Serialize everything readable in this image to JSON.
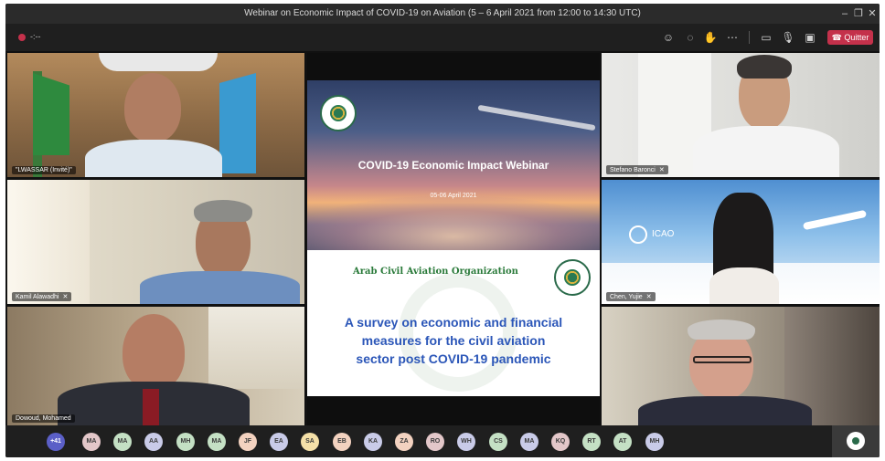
{
  "window": {
    "title": "Webinar on Economic Impact of COVID-19 on Aviation (5 – 6 April 2021 from 12:00 to 14:30 UTC)"
  },
  "toolbar": {
    "timer": "-:--",
    "leave_label": "Quitter"
  },
  "participants": [
    {
      "name": "\"LWASSAR (Invité)\""
    },
    {
      "name": "Kamil Alawadhi"
    },
    {
      "name": "Dowoud, Mohamed"
    },
    {
      "name": "Stefano Baronci"
    },
    {
      "name": "Chen, Yujie"
    },
    {
      "name": ""
    }
  ],
  "presentation": {
    "title": "COVID-19 Economic Impact Webinar",
    "date": "05-06 April 2021",
    "org_name": "Arab Civil Aviation Organization",
    "survey_lines": [
      "A survey on economic and financial",
      "measures for the civil aviation",
      "sector post COVID-19 pandemic"
    ],
    "icao_label": "ICAO"
  },
  "overflow_count": "+41",
  "avatars": [
    {
      "initials": "MA",
      "color": "#e3c7c9"
    },
    {
      "initials": "MA",
      "color": "#c4e0c4"
    },
    {
      "initials": "AA",
      "color": "#c9cbe8"
    },
    {
      "initials": "MH",
      "color": "#c4e0c4"
    },
    {
      "initials": "MA",
      "color": "#c4e0c4"
    },
    {
      "initials": "JF",
      "color": "#f3d2c0"
    },
    {
      "initials": "EA",
      "color": "#c9cbe8"
    },
    {
      "initials": "SA",
      "color": "#f5e0a8"
    },
    {
      "initials": "EB",
      "color": "#f3d2c0"
    },
    {
      "initials": "KA",
      "color": "#c9cbe8"
    },
    {
      "initials": "ZA",
      "color": "#f3d2c0"
    },
    {
      "initials": "RO",
      "color": "#e3c7c9"
    },
    {
      "initials": "WH",
      "color": "#c9cbe8"
    },
    {
      "initials": "CS",
      "color": "#c4e0c4"
    },
    {
      "initials": "MA",
      "color": "#c9cbe8"
    },
    {
      "initials": "KQ",
      "color": "#e3c7c9"
    },
    {
      "initials": "RT",
      "color": "#c4e0c4"
    },
    {
      "initials": "AT",
      "color": "#c4e0c4"
    },
    {
      "initials": "MH",
      "color": "#c9cbe8"
    }
  ]
}
